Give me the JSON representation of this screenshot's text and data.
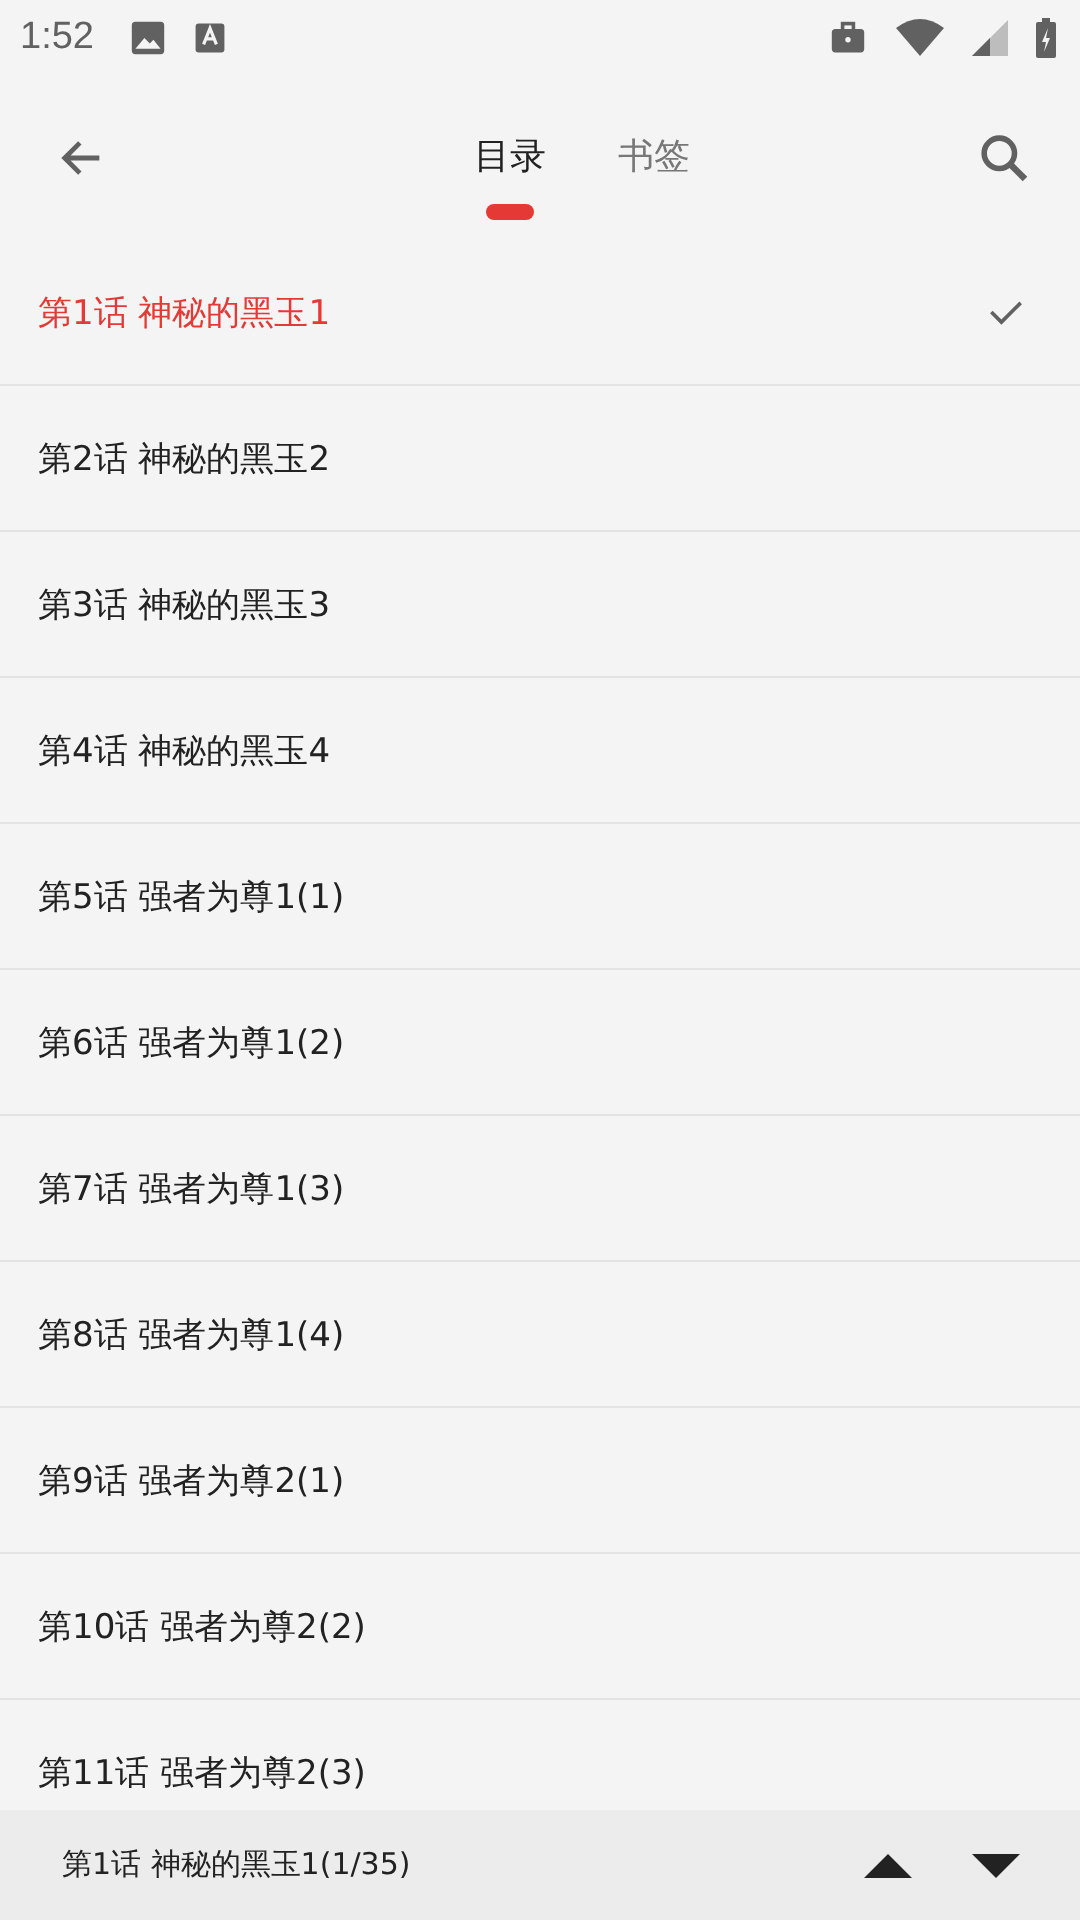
{
  "status_bar": {
    "time": "1:52"
  },
  "tabs": [
    {
      "label": "目录",
      "selected": true
    },
    {
      "label": "书签",
      "selected": false
    }
  ],
  "chapters": [
    {
      "title": "第1话 神秘的黑玉1",
      "selected": true
    },
    {
      "title": "第2话 神秘的黑玉2",
      "selected": false
    },
    {
      "title": "第3话 神秘的黑玉3",
      "selected": false
    },
    {
      "title": "第4话 神秘的黑玉4",
      "selected": false
    },
    {
      "title": "第5话 强者为尊1(1)",
      "selected": false
    },
    {
      "title": "第6话 强者为尊1(2)",
      "selected": false
    },
    {
      "title": "第7话 强者为尊1(3)",
      "selected": false
    },
    {
      "title": "第8话 强者为尊1(4)",
      "selected": false
    },
    {
      "title": "第9话 强者为尊2(1)",
      "selected": false
    },
    {
      "title": "第10话 强者为尊2(2)",
      "selected": false
    },
    {
      "title": "第11话 强者为尊2(3)",
      "selected": false
    }
  ],
  "bottom_bar": {
    "current": "第1话 神秘的黑玉1(1/35)"
  }
}
